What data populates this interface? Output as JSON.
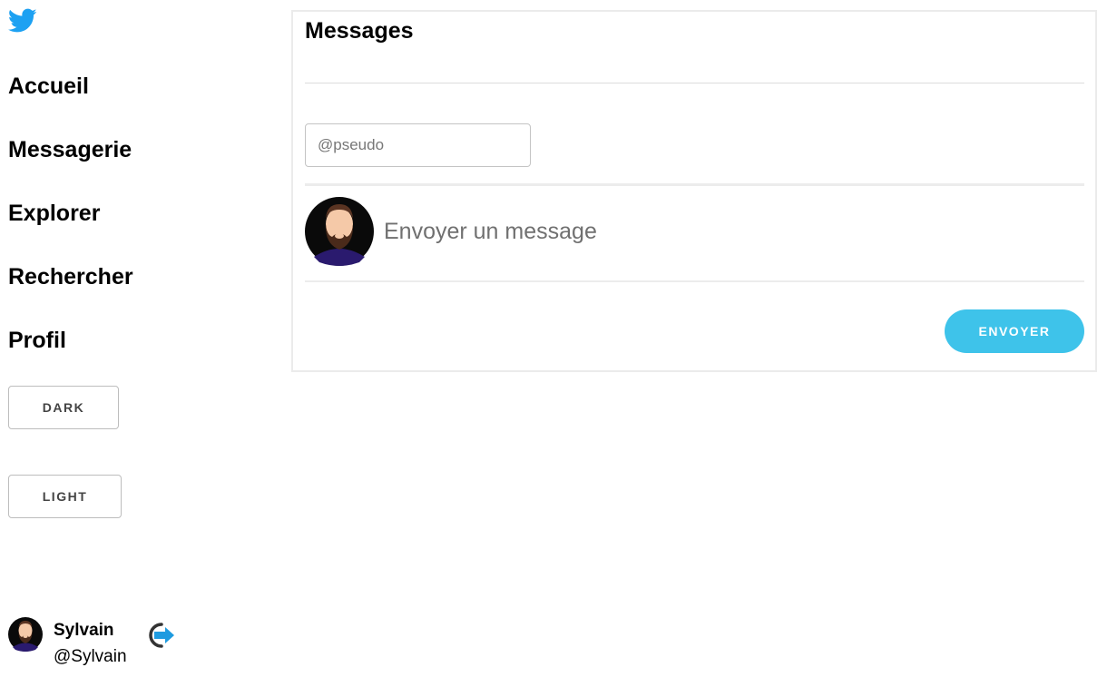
{
  "sidebar": {
    "logo_icon": "twitter-bird-icon",
    "nav": [
      {
        "label": "Accueil"
      },
      {
        "label": "Messagerie"
      },
      {
        "label": "Explorer"
      },
      {
        "label": "Rechercher"
      },
      {
        "label": "Profil"
      }
    ],
    "theme": {
      "dark_label": "DARK",
      "light_label": "LIGHT"
    }
  },
  "profile": {
    "name": "Sylvain",
    "handle": "@Sylvain",
    "logout_icon": "logout-arrow-icon"
  },
  "messages": {
    "title": "Messages",
    "pseudo_placeholder": "@pseudo",
    "compose_placeholder": "Envoyer un message",
    "send_label": "ENVOYER"
  },
  "colors": {
    "accent": "#3ec3ea",
    "logo": "#1da1f2"
  }
}
